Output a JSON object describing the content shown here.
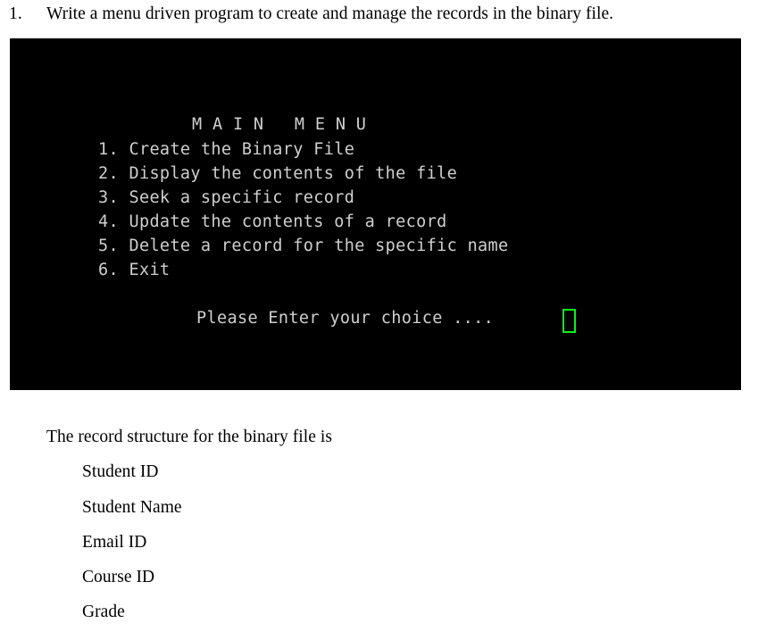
{
  "question": {
    "number": "1.",
    "text": "Write a menu driven program to create and manage the records in the binary file."
  },
  "terminal": {
    "background_color": "#000000",
    "text_color": "#cfcfcf",
    "cursor_color": "#0bf01a",
    "title": "M A I N   M E N U",
    "menu_items": [
      "1. Create the Binary File",
      "2. Display the contents of the file",
      "3. Seek a specific record",
      "4. Update the contents of a record",
      "5. Delete a record for the specific name",
      "6. Exit"
    ],
    "prompt": "Please Enter your choice ....",
    "cursor_value": ""
  },
  "record_structure": {
    "intro": "The record structure for the binary file is",
    "fields": [
      "Student ID",
      "Student Name",
      "Email ID",
      "Course ID",
      "Grade"
    ]
  }
}
